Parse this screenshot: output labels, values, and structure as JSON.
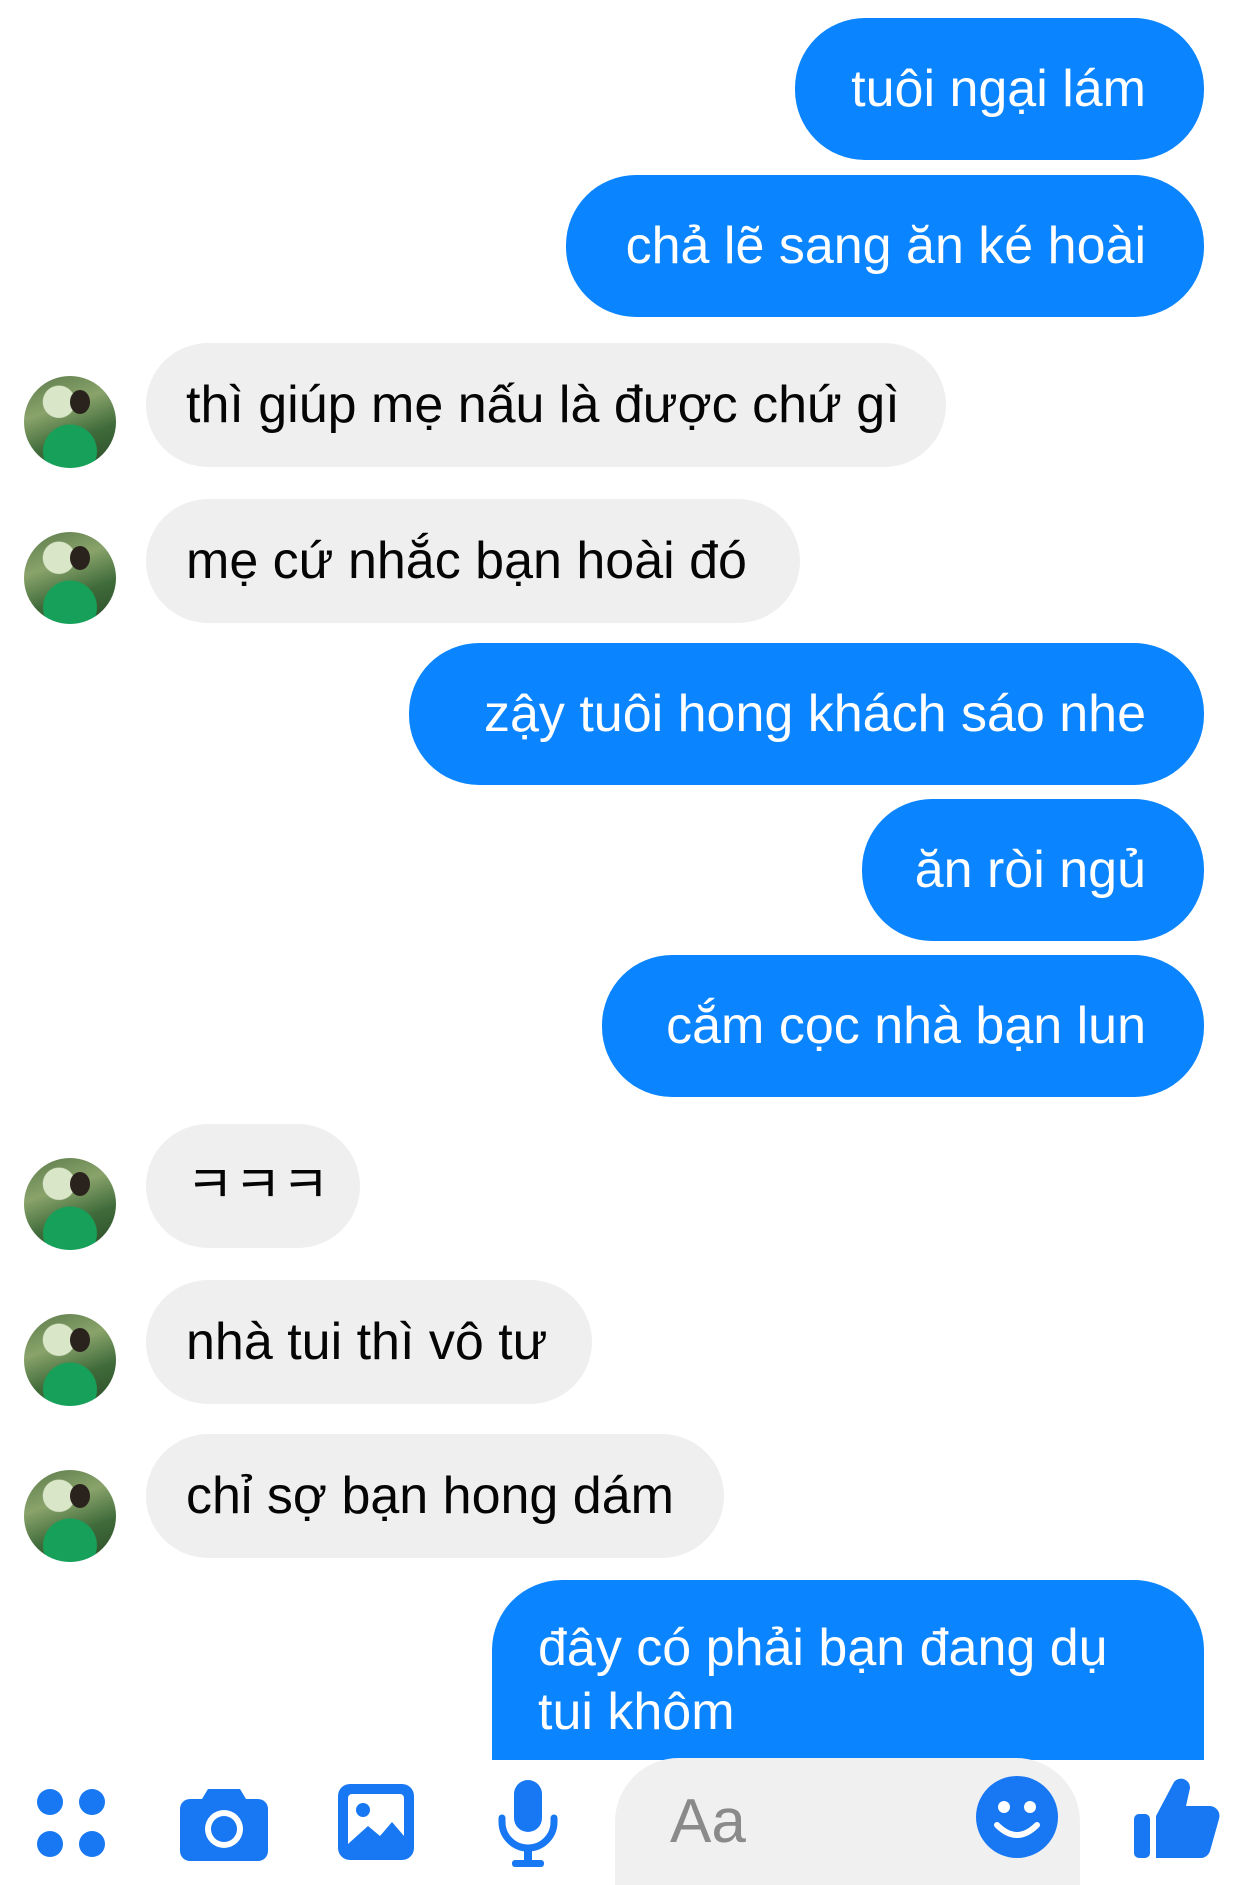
{
  "messages": [
    {
      "dir": "sent",
      "text": "tuôi ngại lám"
    },
    {
      "dir": "sent",
      "text": "chả lẽ sang ăn ké hoài"
    },
    {
      "dir": "received",
      "text": "thì giúp mẹ nấu là được chứ gì"
    },
    {
      "dir": "received",
      "text": "mẹ cứ nhắc bạn hoài đó"
    },
    {
      "dir": "sent",
      "text": "zậy tuôi hong khách sáo nhe"
    },
    {
      "dir": "sent",
      "text": "ăn ròi ngủ"
    },
    {
      "dir": "sent",
      "text": "cắm cọc nhà bạn lun"
    },
    {
      "dir": "received",
      "text": "ㅋㅋㅋ"
    },
    {
      "dir": "received",
      "text": "nhà tui thì vô tư"
    },
    {
      "dir": "received",
      "text": "chỉ sợ bạn hong dám"
    },
    {
      "dir": "sent",
      "text": "đây có phải bạn đang dụ tui khôm"
    }
  ],
  "composer": {
    "placeholder": "Aa"
  },
  "toolbar": {
    "icons": [
      "apps-icon",
      "camera-icon",
      "photo-icon",
      "microphone-icon",
      "emoji-icon",
      "thumbs-up-icon"
    ]
  },
  "colors": {
    "sent_bubble": "#0a84ff",
    "received_bubble": "#efefef",
    "icon_blue": "#1877f2"
  }
}
